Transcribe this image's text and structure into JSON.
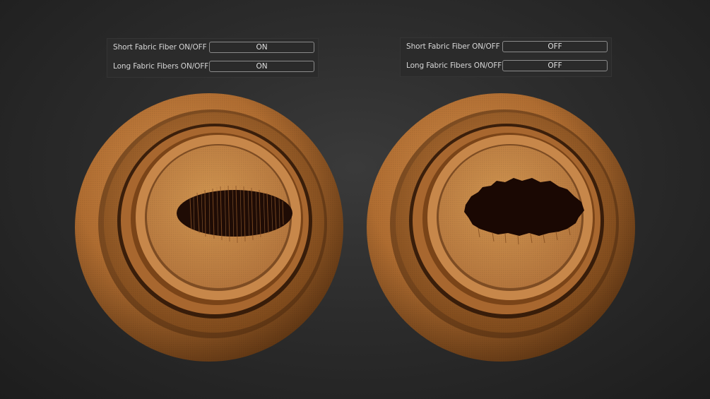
{
  "panels": [
    {
      "rows": [
        {
          "label": "Short Fabric Fiber ON/OFF",
          "value": "ON"
        },
        {
          "label": "Long Fabric Fibers ON/OFF",
          "value": "ON"
        }
      ]
    },
    {
      "rows": [
        {
          "label": "Short Fabric Fiber ON/OFF",
          "value": "OFF"
        },
        {
          "label": "Long Fabric Fibers ON/OFF",
          "value": "OFF"
        }
      ]
    }
  ],
  "colors": {
    "fabric": "#b87436",
    "fabric_highlight": "#d49350",
    "fabric_shadow": "#5a3312",
    "hole": "#1a0904",
    "background": "#2c2c2c"
  }
}
